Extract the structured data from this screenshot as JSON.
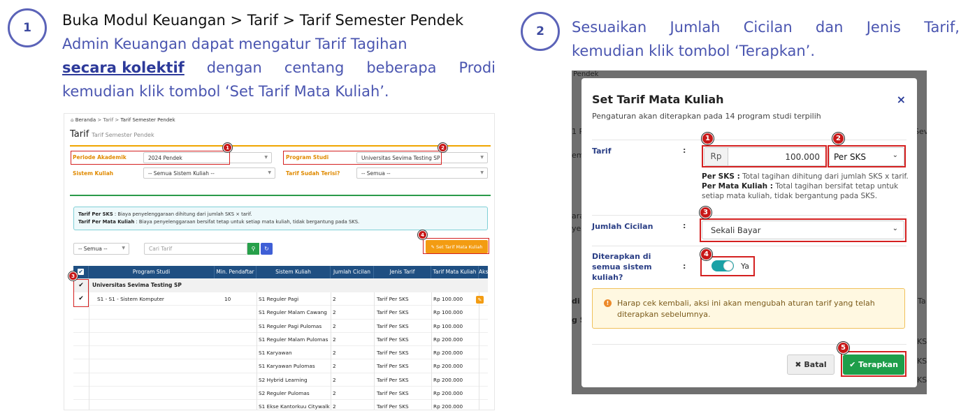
{
  "steps": {
    "one": {
      "number": "1",
      "line1": "Buka Modul Keuangan > Tarif  > Tarif Semester Pendek",
      "line2": "Admin Keuangan dapat mengatur Tarif Tagihan",
      "line3_bold": "secara kolektif",
      "line3_rest": [
        "dengan",
        "centang",
        "beberapa",
        "Prodi"
      ],
      "line4": "kemudian klik tombol ‘Set Tarif Mata Kuliah’."
    },
    "two": {
      "number": "2",
      "line1_words": [
        "Sesuaikan",
        "Jumlah",
        "Cicilan",
        "dan",
        "Jenis",
        "Tarif,"
      ],
      "line2": "kemudian klik tombol ‘Terapkan’."
    }
  },
  "shot1": {
    "breadcrumb": {
      "home": "Beranda",
      "sep": ">",
      "tarif": "Tarif",
      "current": "Tarif Semester Pendek"
    },
    "title": "Tarif",
    "subtitle": "Tarif Semester Pendek",
    "filters": {
      "periode_label": "Periode Akademik",
      "periode_value": "2024 Pendek",
      "program_label": "Program Studi",
      "program_value": "Universitas Sevima Testing SP",
      "sistem_label": "Sistem Kuliah",
      "sistem_value": "-- Semua Sistem Kuliah --",
      "terisi_label": "Tarif Sudah Terisi?",
      "terisi_value": "-- Semua --"
    },
    "info": {
      "sks_label": "Tarif Per SKS",
      "sks_text": ": Biaya penyelenggaraan dihitung dari jumlah SKS × tarif.",
      "mk_label": "Tarif Per Mata Kuliah",
      "mk_text": ": Biaya penyelenggaraan bersifat tetap untuk setiap mata kuliah, tidak bergantung pada SKS."
    },
    "toolbar": {
      "select_value": "-- Semua --",
      "search_placeholder": "Cari Tarif",
      "set_button": "✎ Set Tarif Mata Kuliah"
    },
    "table": {
      "headers": [
        "Program Studi",
        "Min. Pendaftar",
        "Sistem Kuliah",
        "Jumlah Cicilan",
        "Jenis Tarif",
        "Tarif Mata Kuliah",
        "Aksi"
      ],
      "group": "Universitas Sevima Testing SP",
      "prodi": "S1 - S1 - Sistem Komputer",
      "min": "10",
      "rows": [
        {
          "sistem": "S1 Reguler Pagi",
          "cicilan": "2",
          "jenis": "Tarif Per SKS",
          "tarif": "Rp 100.000"
        },
        {
          "sistem": "S1 Reguler Malam Cawang",
          "cicilan": "2",
          "jenis": "Tarif Per SKS",
          "tarif": "Rp 100.000"
        },
        {
          "sistem": "S1 Reguler Pagi Pulomas",
          "cicilan": "2",
          "jenis": "Tarif Per SKS",
          "tarif": "Rp 100.000"
        },
        {
          "sistem": "S1 Reguler Malam Pulomas",
          "cicilan": "2",
          "jenis": "Tarif Per SKS",
          "tarif": "Rp 200.000"
        },
        {
          "sistem": "S1 Karyawan",
          "cicilan": "2",
          "jenis": "Tarif Per SKS",
          "tarif": "Rp 200.000"
        },
        {
          "sistem": "S1 Karyawan Pulomas",
          "cicilan": "2",
          "jenis": "Tarif Per SKS",
          "tarif": "Rp 200.000"
        },
        {
          "sistem": "S2 Hybrid Learning",
          "cicilan": "2",
          "jenis": "Tarif Per SKS",
          "tarif": "Rp 200.000"
        },
        {
          "sistem": "S2 Reguler Pulomas",
          "cicilan": "2",
          "jenis": "Tarif Per SKS",
          "tarif": "Rp 200.000"
        },
        {
          "sistem": "S1 Ekse Kantorkuu Citywalk",
          "cicilan": "2",
          "jenis": "Tarif Per SKS",
          "tarif": "Rp 200.000"
        }
      ]
    },
    "badges": [
      "1",
      "2",
      "3",
      "4"
    ]
  },
  "shot2": {
    "bg": {
      "top": "Pendek",
      "l1": "1 P",
      "l2": "em",
      "l3": "ara",
      "l4": "yel",
      "l5": "di",
      "l6": "g S",
      "r1": "Sev",
      "r2": "Ta",
      "r3": "KS",
      "r4": "KS",
      "r5": "KS"
    },
    "modal": {
      "title": "Set Tarif Mata Kuliah",
      "close": "×",
      "subtitle": "Pengaturan akan diterapkan pada 14 program studi terpilih",
      "tarif_label": "Tarif",
      "colon": ":",
      "currency": "Rp",
      "amount": "100.000",
      "jenis": "Per SKS",
      "note_sks_label": "Per SKS :",
      "note_sks": "Total tagihan dihitung dari jumlah SKS x tarif.",
      "note_mk_label": "Per Mata Kuliah :",
      "note_mk": "Total tagihan bersifat tetap untuk setiap mata kuliah, tidak bergantung pada SKS.",
      "cicilan_label": "Jumlah Cicilan",
      "cicilan_value": "Sekali Bayar",
      "diterapkan_label": "Diterapkan di semua sistem kuliah?",
      "toggle_text": "Ya",
      "warning": "Harap cek kembali, aksi ini akan mengubah aturan tarif yang telah diterapkan sebelumnya.",
      "batal": "✖ Batal",
      "terapkan": "✔ Terapkan"
    },
    "badges": [
      "1",
      "2",
      "3",
      "4",
      "5"
    ]
  },
  "colors": {
    "accent": "#4a55b0",
    "badge": "#c81818",
    "header": "#1f4f82",
    "orange": "#f39c12",
    "green": "#1e9e4a"
  }
}
